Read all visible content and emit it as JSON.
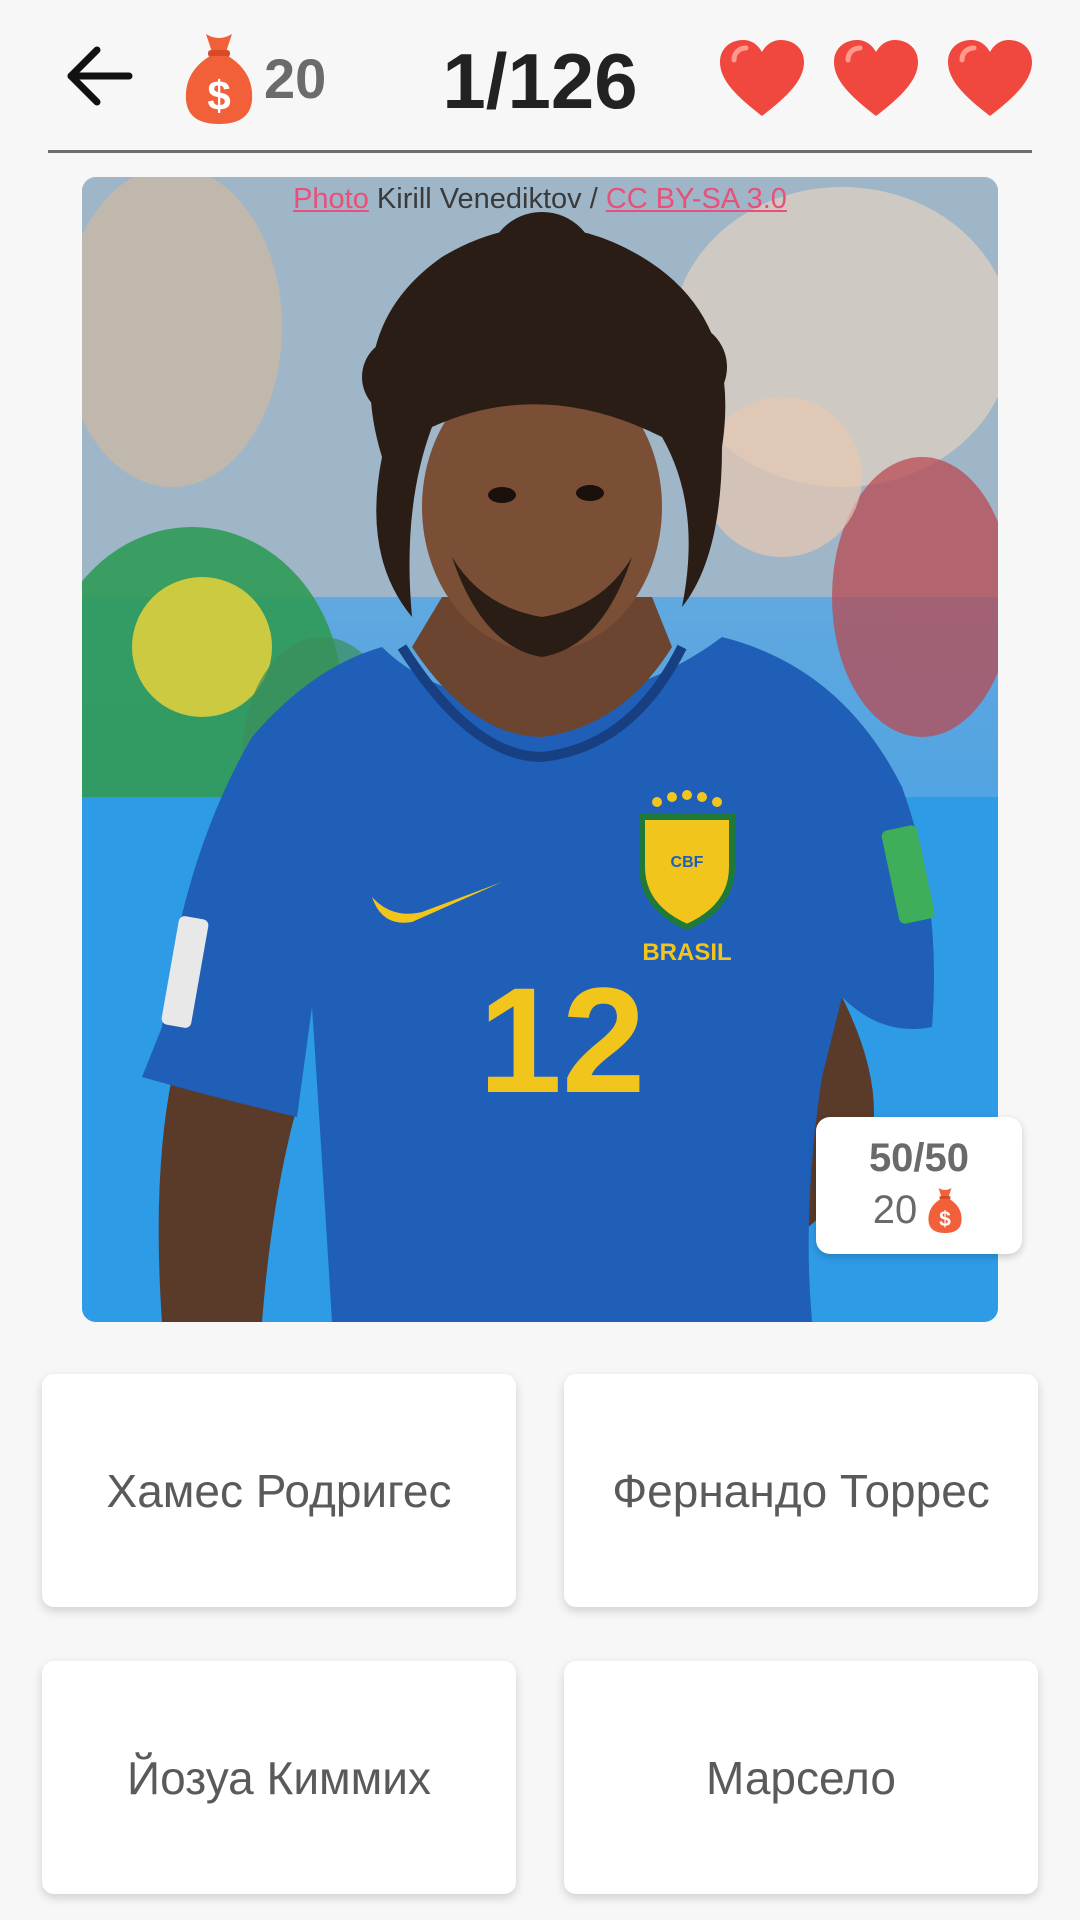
{
  "header": {
    "coins": "20",
    "progress": "1/126",
    "lives": 3,
    "heart_color": "#f0483e"
  },
  "photo": {
    "credit_prefix": "Photo",
    "credit_author": " Kirill Venediktov / ",
    "credit_license": "CC BY-SA 3.0",
    "jersey_text": "BRASIL",
    "jersey_crest": "CBF",
    "jersey_number": "12"
  },
  "hint": {
    "ratio": "50/50",
    "cost": "20"
  },
  "answers": [
    {
      "label": "Хамес Родригес"
    },
    {
      "label": "Фернандо Торрес"
    },
    {
      "label": "Йозуа Киммих"
    },
    {
      "label": "Марсело"
    }
  ],
  "colors": {
    "background": "#f7f7f7",
    "bag": "#f2603a",
    "link": "#e8507a",
    "jersey": "#1f5fb8",
    "jersey_yellow": "#f2c51c"
  }
}
